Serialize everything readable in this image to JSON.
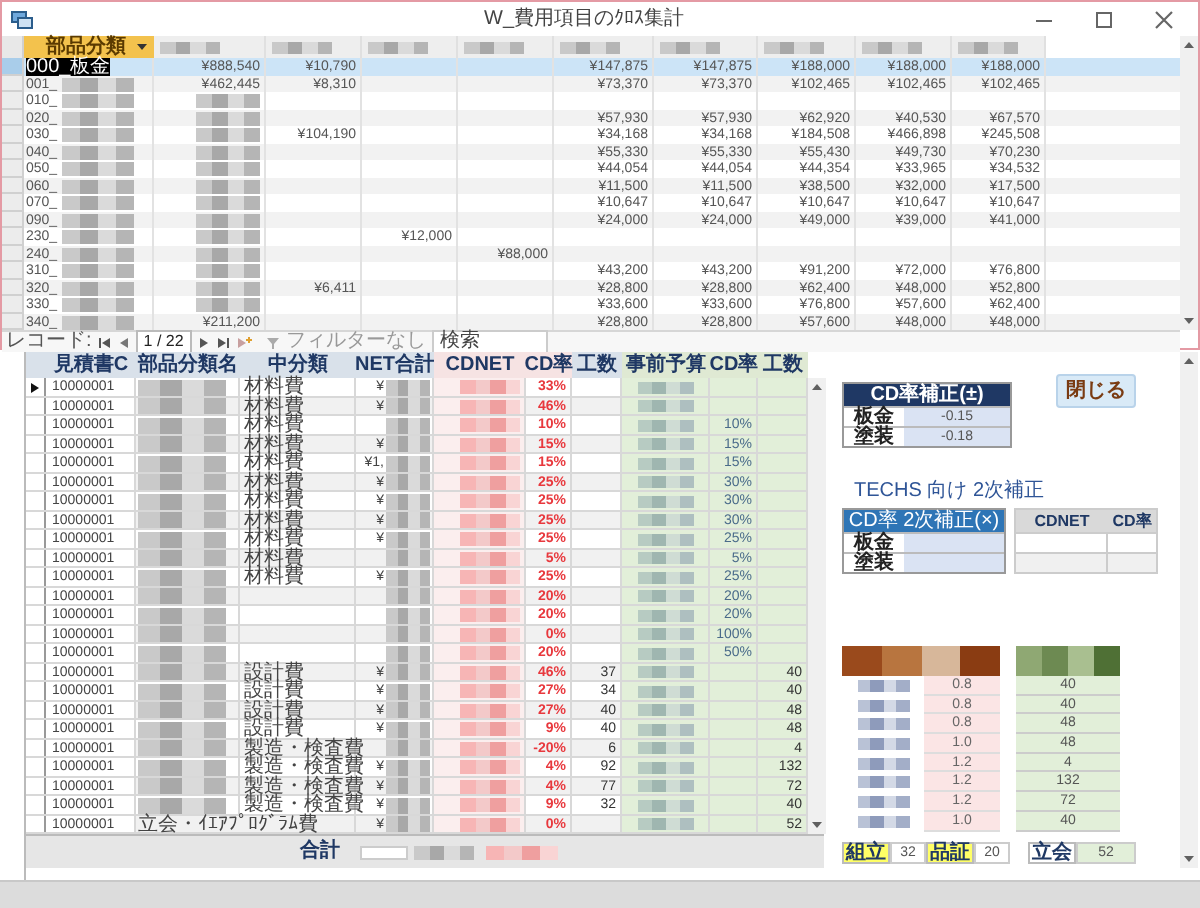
{
  "window": {
    "title": "W_費用項目のｸﾛｽ集計"
  },
  "datasheet": {
    "columns": [
      {
        "kind": "text",
        "label": "部品分類"
      },
      {
        "kind": "redacted"
      },
      {
        "kind": "redacted"
      },
      {
        "kind": "redacted"
      },
      {
        "kind": "redacted"
      },
      {
        "kind": "redacted"
      },
      {
        "kind": "redacted"
      },
      {
        "kind": "redacted"
      },
      {
        "kind": "redacted"
      },
      {
        "kind": "redacted"
      }
    ],
    "rows": [
      {
        "selected": true,
        "cells": [
          "000_板金",
          "¥888,540",
          "¥10,790",
          null,
          null,
          "¥147,875",
          "¥147,875",
          "¥188,000",
          "¥188,000",
          "¥188,000"
        ]
      },
      {
        "selected": false,
        "cells": [
          {
            "kind": "partial",
            "text": "001_"
          },
          "¥462,445",
          "¥8,310",
          null,
          null,
          "¥73,370",
          "¥73,370",
          "¥102,465",
          "¥102,465",
          "¥102,465"
        ]
      },
      {
        "selected": false,
        "cells": [
          {
            "kind": "partial",
            "text": "010_"
          },
          {
            "kind": "redacted"
          },
          null,
          null,
          null,
          null,
          null,
          null,
          null,
          null
        ]
      },
      {
        "selected": false,
        "cells": [
          {
            "kind": "partial",
            "text": "020_"
          },
          {
            "kind": "redacted"
          },
          null,
          null,
          null,
          "¥57,930",
          "¥57,930",
          "¥62,920",
          "¥40,530",
          "¥67,570"
        ]
      },
      {
        "selected": false,
        "cells": [
          {
            "kind": "partial",
            "text": "030_"
          },
          {
            "kind": "redacted"
          },
          "¥104,190",
          null,
          null,
          "¥34,168",
          "¥34,168",
          "¥184,508",
          "¥466,898",
          "¥245,508"
        ]
      },
      {
        "selected": false,
        "cells": [
          {
            "kind": "partial",
            "text": "040_"
          },
          {
            "kind": "redacted"
          },
          null,
          null,
          null,
          "¥55,330",
          "¥55,330",
          "¥55,430",
          "¥49,730",
          "¥70,230"
        ]
      },
      {
        "selected": false,
        "cells": [
          {
            "kind": "partial",
            "text": "050_"
          },
          {
            "kind": "redacted"
          },
          null,
          null,
          null,
          "¥44,054",
          "¥44,054",
          "¥44,354",
          "¥33,965",
          "¥34,532"
        ]
      },
      {
        "selected": false,
        "cells": [
          {
            "kind": "partial",
            "text": "060_"
          },
          {
            "kind": "redacted"
          },
          null,
          null,
          null,
          "¥11,500",
          "¥11,500",
          "¥38,500",
          "¥32,000",
          "¥17,500"
        ]
      },
      {
        "selected": false,
        "cells": [
          {
            "kind": "partial",
            "text": "070_"
          },
          {
            "kind": "redacted"
          },
          null,
          null,
          null,
          "¥10,647",
          "¥10,647",
          "¥10,647",
          "¥10,647",
          "¥10,647"
        ]
      },
      {
        "selected": false,
        "cells": [
          {
            "kind": "partial",
            "text": "090_"
          },
          {
            "kind": "redacted"
          },
          null,
          null,
          null,
          "¥24,000",
          "¥24,000",
          "¥49,000",
          "¥39,000",
          "¥41,000"
        ]
      },
      {
        "selected": false,
        "cells": [
          {
            "kind": "partial",
            "text": "230_"
          },
          {
            "kind": "redacted"
          },
          null,
          "¥12,000",
          null,
          null,
          null,
          null,
          null,
          null
        ]
      },
      {
        "selected": false,
        "cells": [
          {
            "kind": "partial",
            "text": "240_"
          },
          {
            "kind": "redacted"
          },
          null,
          null,
          "¥88,000",
          null,
          null,
          null,
          null,
          null
        ]
      },
      {
        "selected": false,
        "cells": [
          {
            "kind": "partial",
            "text": "310_"
          },
          {
            "kind": "redacted"
          },
          null,
          null,
          null,
          "¥43,200",
          "¥43,200",
          "¥91,200",
          "¥72,000",
          "¥76,800"
        ]
      },
      {
        "selected": false,
        "cells": [
          {
            "kind": "partial",
            "text": "320_"
          },
          {
            "kind": "redacted"
          },
          "¥6,411",
          null,
          null,
          "¥28,800",
          "¥28,800",
          "¥62,400",
          "¥48,000",
          "¥52,800"
        ]
      },
      {
        "selected": false,
        "cells": [
          {
            "kind": "partial",
            "text": "330_"
          },
          {
            "kind": "redacted"
          },
          null,
          null,
          null,
          "¥33,600",
          "¥33,600",
          "¥76,800",
          "¥57,600",
          "¥62,400"
        ]
      },
      {
        "selected": false,
        "cells": [
          {
            "kind": "partial",
            "text": "340_"
          },
          "¥211,200",
          null,
          null,
          null,
          "¥28,800",
          "¥28,800",
          "¥57,600",
          "¥48,000",
          "¥48,000"
        ]
      }
    ]
  },
  "record_nav": {
    "label": "レコード:",
    "position": "1 / 22",
    "filter": "フィルターなし",
    "search": "検索"
  },
  "subform": {
    "columns": [
      "見積書C",
      "部品分類名",
      "中分類",
      "NET合計",
      "CDNET",
      "CD率",
      "工数",
      "事前予算",
      "CD率",
      "工数"
    ],
    "rows": [
      {
        "current": true,
        "code": "10000001",
        "name": {
          "kind": "redacted"
        },
        "category": "材料費",
        "net": "¥",
        "cd_rate": "33%"
      },
      {
        "current": false,
        "code": "10000001",
        "name": {
          "kind": "redacted"
        },
        "category": "材料費",
        "net": "¥",
        "cd_rate": "46%"
      },
      {
        "current": false,
        "code": "10000001",
        "name": {
          "kind": "redacted"
        },
        "category": "材料費",
        "cd_rate": "10%",
        "budget_rate": "10%"
      },
      {
        "current": false,
        "code": "10000001",
        "name": {
          "kind": "redacted"
        },
        "category": "材料費",
        "net": "¥",
        "cd_rate": "15%",
        "budget_rate": "15%"
      },
      {
        "current": false,
        "code": "10000001",
        "name": {
          "kind": "redacted"
        },
        "category": "材料費",
        "net": "¥1,",
        "cd_rate": "15%",
        "budget_rate": "15%"
      },
      {
        "current": false,
        "code": "10000001",
        "name": {
          "kind": "redacted"
        },
        "category": "材料費",
        "net": "¥",
        "cd_rate": "25%",
        "budget_rate": "30%"
      },
      {
        "current": false,
        "code": "10000001",
        "name": {
          "kind": "redacted"
        },
        "category": "材料費",
        "net": "¥",
        "cd_rate": "25%",
        "budget_rate": "30%"
      },
      {
        "current": false,
        "code": "10000001",
        "name": {
          "kind": "redacted"
        },
        "category": "材料費",
        "net": "¥",
        "cd_rate": "25%",
        "budget_rate": "30%"
      },
      {
        "current": false,
        "code": "10000001",
        "name": {
          "kind": "redacted"
        },
        "category": "材料費",
        "net": "¥",
        "cd_rate": "25%",
        "budget_rate": "25%"
      },
      {
        "current": false,
        "code": "10000001",
        "name": {
          "kind": "redacted"
        },
        "category": "材料費",
        "cd_rate": "5%",
        "budget_rate": "5%"
      },
      {
        "current": false,
        "code": "10000001",
        "name": {
          "kind": "redacted"
        },
        "category": "材料費",
        "net": "¥",
        "cd_rate": "25%",
        "budget_rate": "25%"
      },
      {
        "current": false,
        "code": "10000001",
        "name": {
          "kind": "redacted"
        },
        "cd_rate": "20%",
        "budget_rate": "20%"
      },
      {
        "current": false,
        "code": "10000001",
        "name": {
          "kind": "redacted"
        },
        "cd_rate": "20%",
        "budget_rate": "20%"
      },
      {
        "current": false,
        "code": "10000001",
        "name": {
          "kind": "redacted"
        },
        "cd_rate": "0%",
        "budget_rate": "100%"
      },
      {
        "current": false,
        "code": "10000001",
        "name": {
          "kind": "redacted"
        },
        "cd_rate": "20%",
        "budget_rate": "50%"
      },
      {
        "current": false,
        "code": "10000001",
        "name": {
          "kind": "redacted"
        },
        "category": "設計費",
        "net": "¥",
        "cd_rate": "46%",
        "hours": "37",
        "budget_hours": "40"
      },
      {
        "current": false,
        "code": "10000001",
        "name": {
          "kind": "redacted"
        },
        "category": "設計費",
        "net": "¥",
        "cd_rate": "27%",
        "hours": "34",
        "budget_hours": "40"
      },
      {
        "current": false,
        "code": "10000001",
        "name": {
          "kind": "redacted"
        },
        "category": "設計費",
        "net": "¥",
        "cd_rate": "27%",
        "hours": "40",
        "budget_hours": "48"
      },
      {
        "current": false,
        "code": "10000001",
        "name": {
          "kind": "redacted"
        },
        "category": "設計費",
        "net": "¥",
        "cd_rate": "9%",
        "hours": "40",
        "budget_hours": "48"
      },
      {
        "current": false,
        "code": "10000001",
        "name": {
          "kind": "redacted"
        },
        "category": "製造・検査費",
        "cd_rate": "-20%",
        "hours": "6",
        "budget_hours": "4"
      },
      {
        "current": false,
        "code": "10000001",
        "name": {
          "kind": "redacted"
        },
        "category": "製造・検査費",
        "net": "¥",
        "cd_rate": "4%",
        "hours": "92",
        "budget_hours": "132"
      },
      {
        "current": false,
        "code": "10000001",
        "name": {
          "kind": "redacted"
        },
        "category": "製造・検査費",
        "net": "¥",
        "cd_rate": "4%",
        "hours": "77",
        "budget_hours": "72"
      },
      {
        "current": false,
        "code": "10000001",
        "name": {
          "kind": "redacted"
        },
        "category": "製造・検査費",
        "net": "¥",
        "cd_rate": "9%",
        "hours": "32",
        "budget_hours": "40"
      },
      {
        "current": false,
        "code": "10000001",
        "name": "立会・ｲｴｱﾌﾟﾛｸﾞﾗﾑ費",
        "net": "¥",
        "cd_rate": "0%",
        "budget_hours": "52"
      }
    ],
    "footer_label": "合計"
  },
  "cd_correction": {
    "title": "CD率補正(±)",
    "rows": [
      {
        "label": "板金",
        "value": "-0.15"
      },
      {
        "label": "塗装",
        "value": "-0.18"
      }
    ]
  },
  "close_button": "閉じる",
  "techs_title": "TECHS 向け 2次補正",
  "secondary_correction": {
    "title": "CD率 2次補正(×)",
    "rows": [
      {
        "label": "板金"
      },
      {
        "label": "塗装"
      }
    ]
  },
  "cdnet_table": {
    "columns": [
      "CDNET",
      "CD率"
    ]
  },
  "factor_table": {
    "values": [
      "0.8",
      "0.8",
      "0.8",
      "1.0",
      "1.2",
      "1.2",
      "1.2",
      "1.0"
    ]
  },
  "hours_table": {
    "values": [
      "40",
      "40",
      "48",
      "48",
      "4",
      "132",
      "72",
      "40"
    ]
  },
  "totals": [
    {
      "label": "組立",
      "value": "32"
    },
    {
      "label": "品証",
      "value": "20"
    }
  ],
  "inspection_total": {
    "label": "立会",
    "value": "52"
  }
}
